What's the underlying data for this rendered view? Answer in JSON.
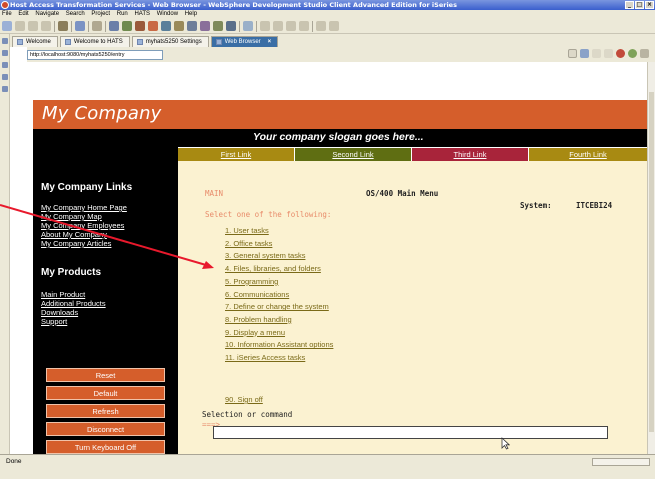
{
  "window": {
    "title": "Host Access Transformation Services - Web Browser - WebSphere Development Studio Client Advanced Edition for iSeries",
    "buttons": [
      "_",
      "□",
      "×"
    ]
  },
  "menubar": [
    "File",
    "Edit",
    "Navigate",
    "Search",
    "Project",
    "Run",
    "HATS",
    "Window",
    "Help"
  ],
  "tabs": [
    {
      "label": "Welcome"
    },
    {
      "label": "Welcome to HATS"
    },
    {
      "label": "myhats5250 Settings"
    },
    {
      "label": "Web Browser",
      "active": true,
      "close": "×"
    }
  ],
  "address": {
    "url": "http://localhost:9080/myhats5250/entry"
  },
  "page": {
    "company": "My Company",
    "slogan": "Your company slogan goes here...",
    "top_links": [
      {
        "label": "First Link",
        "color": "#a88a12"
      },
      {
        "label": "Second Link",
        "color": "#5f6e12"
      },
      {
        "label": "Third Link",
        "color": "#a8243a"
      },
      {
        "label": "Fourth Link",
        "color": "#a88a12"
      }
    ],
    "sidebar": {
      "links_heading": "My Company Links",
      "links": [
        "My Company Home Page",
        "My Company Map",
        "My Company Employees",
        "About My Company",
        "My Company Articles"
      ],
      "products_heading": "My Products",
      "products": [
        "Main Product",
        "Additional Products",
        "Downloads",
        "Support"
      ],
      "buttons": [
        "Reset",
        "Default",
        "Refresh",
        "Disconnect",
        "Turn Keyboard Off"
      ]
    },
    "terminal": {
      "main_label": "MAIN",
      "title": "OS/400 Main Menu",
      "system_label": "System:",
      "system_name": "ITCEBI24",
      "prompt": "Select one of the following:",
      "menu_items": [
        "1. User tasks",
        "2. Office tasks",
        "3. General system tasks",
        "4. Files, libraries, and folders",
        "5. Programming",
        "6. Communications",
        "7. Define or change the system",
        "8. Problem handling",
        "9. Display a menu",
        "10. Information Assistant options",
        "11. iSeries Access tasks"
      ],
      "signoff": "90. Sign off",
      "command_label": "Selection or command",
      "command_prompt": "===>"
    }
  },
  "status": {
    "text": "Done"
  },
  "colors": {
    "accent_orange": "#d55e2b",
    "terminal_bg": "#fbf2d1",
    "annotation_arrow": "#e8192c"
  }
}
